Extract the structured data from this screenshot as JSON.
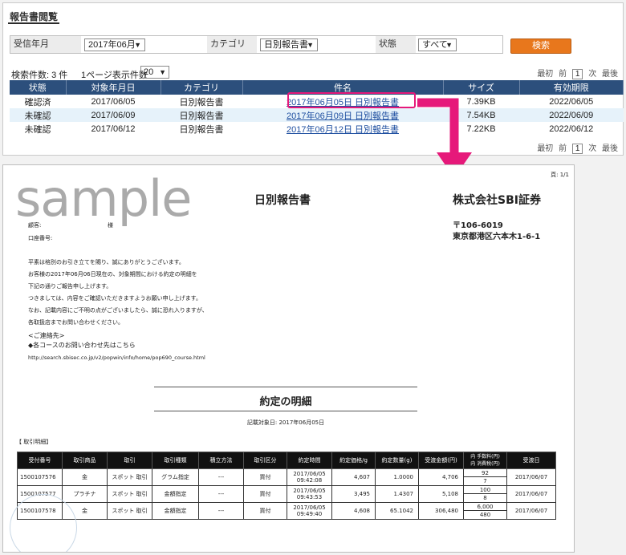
{
  "panel": {
    "title": "報告書閲覧",
    "filters": {
      "month_label": "受信年月",
      "month_value": "2017年06月",
      "category_label": "カテゴリ",
      "category_value": "日別報告書",
      "status_label": "状態",
      "status_value": "すべて",
      "search_button": "検索"
    },
    "result_count": "検索件数: 3 件",
    "per_page_label": "1ページ表示件数",
    "per_page_value": "20",
    "pager": {
      "first": "最初",
      "prev": "前",
      "current": "1",
      "next": "次",
      "last": "最後"
    },
    "columns": [
      "状態",
      "対象年月日",
      "カテゴリ",
      "件名",
      "サイズ",
      "有効期限"
    ],
    "rows": [
      {
        "status": "確認済",
        "date": "2017/06/05",
        "category": "日別報告書",
        "subject": "2017年06月05日 日別報告書",
        "size": "7.39KB",
        "expiry": "2022/06/05"
      },
      {
        "status": "未確認",
        "date": "2017/06/09",
        "category": "日別報告書",
        "subject": "2017年06月09日 日別報告書",
        "size": "7.54KB",
        "expiry": "2022/06/09"
      },
      {
        "status": "未確認",
        "date": "2017/06/12",
        "category": "日別報告書",
        "subject": "2017年06月12日 日別報告書",
        "size": "7.22KB",
        "expiry": "2022/06/12"
      }
    ],
    "highlight_color": "#e6197a"
  },
  "doc": {
    "page": "頁:  1/1",
    "watermark": "sample",
    "title": "日別報告書",
    "company": "株式会社SBI証券",
    "postcode": "〒106-6019",
    "address": "東京都港区六本木1-6-1",
    "customer_label": "顧客:",
    "honorific": "様",
    "account_label": "口座番号:",
    "paragraphs": [
      "平素は格別のお引き立てを賜り、誠にありがとうございます。",
      "お客様の2017年06月06日現在の、対象期間における約定の明細を",
      "下記の通りご報告申し上げます。",
      "つきましては、内容をご確認いただきますようお願い申し上げます。",
      "なお、記載内容にご不明の点がございましたら、誠に恐れ入りますが、",
      "各取扱店までお問い合わせください。"
    ],
    "contact_head": "<ご連絡先>",
    "course_link": "◆各コースのお問い合わせ先はこちら",
    "course_url": "http://search.sbisec.co.jp/v2/popwin/info/home/pop690_course.html",
    "section_title": "約定の明細",
    "record_date": "記載対象日: 2017年06月05日",
    "trade_section": "【 取引明細】",
    "trade_columns": [
      "受付番号",
      "取引商品",
      "取引",
      "取引種類",
      "積立方法",
      "取引区分",
      "約定時間",
      "約定価格/g",
      "約定数量(g)",
      "受渡金額(円)",
      "内 手数料(円)",
      "内 消費税(円)",
      "受渡日"
    ],
    "trades": [
      {
        "id": "1500107576",
        "product": "金",
        "trade": "スポット 取引",
        "type": "グラム指定",
        "plan": "---",
        "side": "買付",
        "time1": "2017/06/05",
        "time2": "09:42:08",
        "price": "4,607",
        "qty": "1.0000",
        "amount": "4,706",
        "fee": "92",
        "tax": "7",
        "settle": "2017/06/07"
      },
      {
        "id": "1500107577",
        "product": "プラチナ",
        "trade": "スポット 取引",
        "type": "金額指定",
        "plan": "---",
        "side": "買付",
        "time1": "2017/06/05",
        "time2": "09:43:53",
        "price": "3,495",
        "qty": "1.4307",
        "amount": "5,108",
        "fee": "100",
        "tax": "8",
        "settle": "2017/06/07"
      },
      {
        "id": "1500107578",
        "product": "金",
        "trade": "スポット 取引",
        "type": "金額指定",
        "plan": "---",
        "side": "買付",
        "time1": "2017/06/05",
        "time2": "09:49:40",
        "price": "4,608",
        "qty": "65.1042",
        "amount": "306,480",
        "fee": "6,000",
        "tax": "480",
        "settle": "2017/06/07"
      }
    ]
  }
}
